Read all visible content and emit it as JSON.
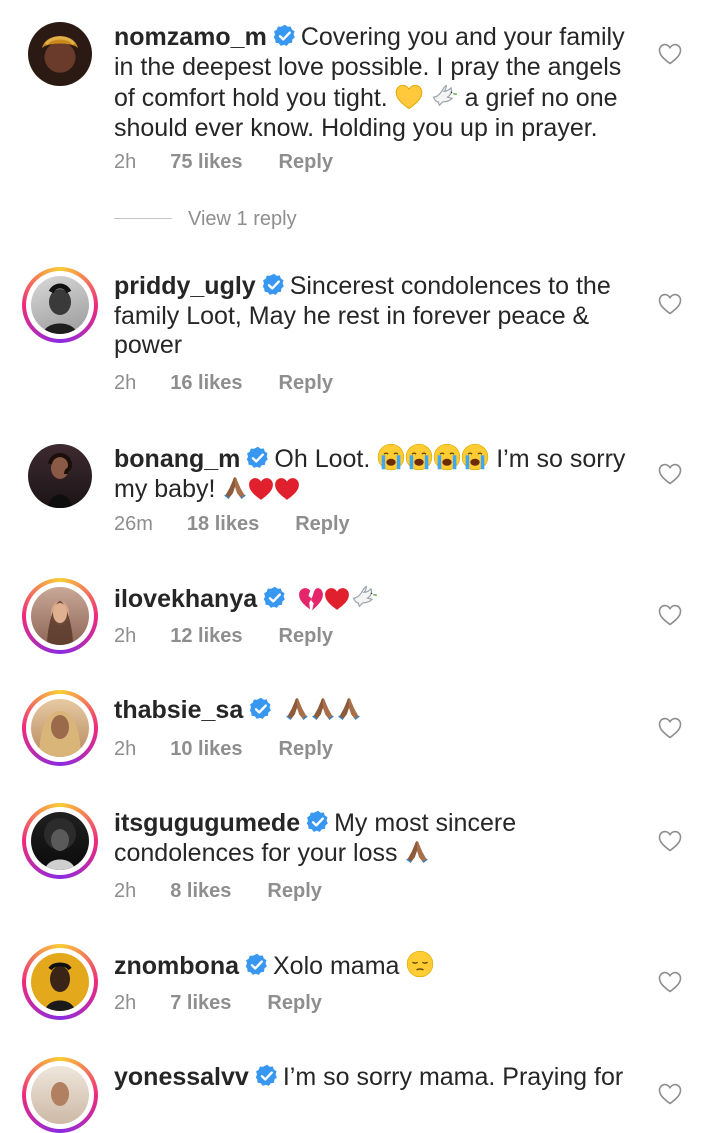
{
  "comments": [
    {
      "username": "nomzamo_m",
      "lines": [
        "Covering you and your family",
        "in the deepest love possible. I pray the angels",
        "of comfort hold you tight.",
        "a grief no one",
        "should ever know. Holding you up in prayer."
      ],
      "time": "2h",
      "likes": "75 likes",
      "reply": "Reply"
    },
    {
      "username": "priddy_ugly",
      "lines": [
        "Sincerest condolences to the",
        "family Loot, May he rest in forever peace &",
        "power"
      ],
      "time": "2h",
      "likes": "16 likes",
      "reply": "Reply"
    },
    {
      "username": "bonang_m",
      "lines": [
        "Oh Loot.",
        "I’m so sorry",
        "my baby!"
      ],
      "time": "26m",
      "likes": "18 likes",
      "reply": "Reply"
    },
    {
      "username": "ilovekhanya",
      "lines": [],
      "time": "2h",
      "likes": "12 likes",
      "reply": "Reply"
    },
    {
      "username": "thabsie_sa",
      "lines": [],
      "time": "2h",
      "likes": "10 likes",
      "reply": "Reply"
    },
    {
      "username": "itsgugugumede",
      "lines": [
        "My most sincere",
        "condolences for your loss"
      ],
      "time": "2h",
      "likes": "8 likes",
      "reply": "Reply"
    },
    {
      "username": "znombona",
      "lines": [
        "Xolo mama"
      ],
      "time": "2h",
      "likes": "7 likes",
      "reply": "Reply"
    },
    {
      "username": "yonessalvv",
      "lines": [
        "I’m so sorry mama. Praying for"
      ]
    }
  ],
  "view_replies": "View 1 reply",
  "colors": {
    "verified": "#3897f0",
    "muted": "#8e8e8e",
    "text": "#262626"
  },
  "icons": [
    "verified-badge-icon",
    "heart-icon",
    "yellow-heart-emoji",
    "dove-emoji",
    "crying-face-emoji",
    "folded-hands-emoji",
    "red-heart-emoji",
    "broken-heart-emoji",
    "pensive-face-emoji"
  ]
}
